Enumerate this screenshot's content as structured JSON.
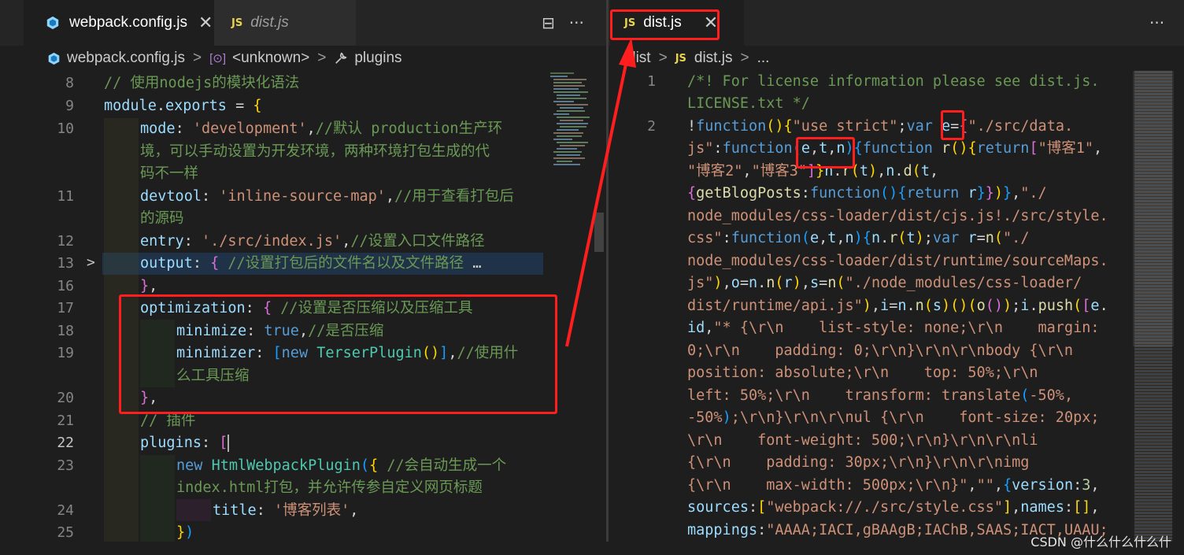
{
  "left_pane": {
    "tabs": [
      {
        "label": "webpack.config.js",
        "close": "✕",
        "icon": "webpack-icon"
      },
      {
        "label": "dist.js",
        "badge": "JS"
      }
    ],
    "actions": {
      "split": "⊟",
      "more": "···"
    },
    "breadcrumb": {
      "file": "webpack.config.js",
      "symbol": "<unknown>",
      "prop": "plugins",
      "sep": ">"
    },
    "line_numbers": [
      "8",
      "9",
      "10",
      "",
      "",
      "11",
      "",
      "12",
      "13",
      "16",
      "17",
      "18",
      "19",
      "",
      "20",
      "21",
      "22",
      "23",
      "",
      "24",
      "25"
    ],
    "fold_marker": ">"
  },
  "right_pane": {
    "tab": {
      "label": "dist.js",
      "badge": "JS",
      "close": "✕"
    },
    "actions": {
      "more": "···"
    },
    "breadcrumb": {
      "folder": "dist",
      "file": "dist.js",
      "more": "...",
      "badge": "JS",
      "sep": ">"
    },
    "line_numbers": [
      "1",
      "",
      "2"
    ]
  },
  "watermark": "CSDN @什么什么什么什",
  "colors": {
    "annotation_red": "#ff1e1e",
    "editor_bg": "#1e1e1e",
    "tabbar_bg": "#252526"
  }
}
